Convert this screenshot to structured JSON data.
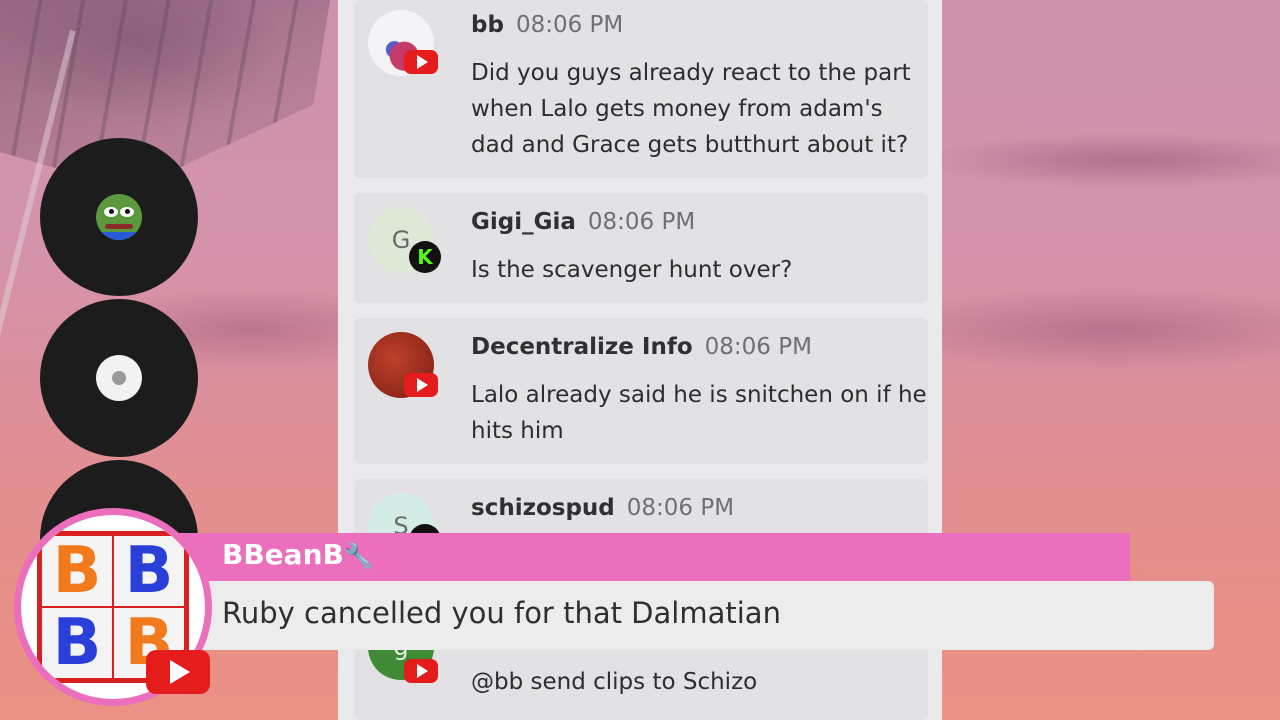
{
  "messages": [
    {
      "username": "bb",
      "time": "08:06 PM",
      "text": "Did you guys already react to the part when Lalo gets money from adam's dad and Grace gets butthurt about it?",
      "platform": "youtube-icon"
    },
    {
      "username": "Gigi_Gia",
      "time": "08:06 PM",
      "text": "Is the scavenger hunt over?",
      "avatar_letter": "G",
      "platform": "kick-icon",
      "platform_letter": "K"
    },
    {
      "username": "Decentralize Info",
      "time": "08:06 PM",
      "text": "Lalo already said he is snitchen on if he hits him",
      "platform": "youtube-icon"
    },
    {
      "username": "schizospud",
      "time": "08:06 PM",
      "text": "",
      "avatar_letter": "S",
      "platform": "kick-icon"
    },
    {
      "username": "",
      "time": "",
      "text": "@bb send clips to Schizo",
      "avatar_letter": "g",
      "platform": "youtube-icon"
    }
  ],
  "highlight": {
    "username": "BBeanB",
    "badge_icon": "wrench-icon",
    "badge_glyph": "🔧",
    "text": "Ruby cancelled you for that Dalmatian",
    "logo_letters": [
      "B",
      "B",
      "B",
      "B"
    ],
    "platform": "youtube-icon"
  },
  "colors": {
    "chat_bg": "#eaeaec",
    "message_bg": "#e2e2e4",
    "highlight_pink": "#ec6fbe",
    "youtube_red": "#e51c1c",
    "kick_green": "#53fc18"
  }
}
